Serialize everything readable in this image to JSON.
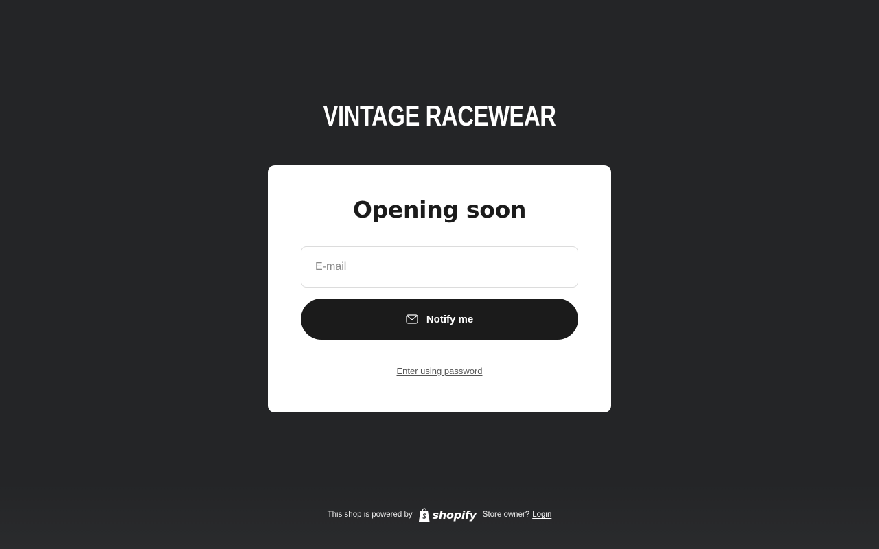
{
  "store": {
    "title": "VINTAGE RACEWEAR"
  },
  "card": {
    "heading": "Opening soon",
    "email": {
      "value": "",
      "placeholder": "E-mail"
    },
    "notify_button": {
      "label": "Notify me",
      "icon": "mail-icon"
    },
    "password_link": "Enter using password"
  },
  "footer": {
    "powered_text": "This shop is powered by",
    "brand_logo": "shopify",
    "owner_text": "Store owner?",
    "login_link": "Login"
  },
  "colors": {
    "background": "#242527",
    "card": "#ffffff",
    "button": "#1b1b1b",
    "text_dark": "#1b1b1b",
    "text_light": "#ffffff"
  }
}
